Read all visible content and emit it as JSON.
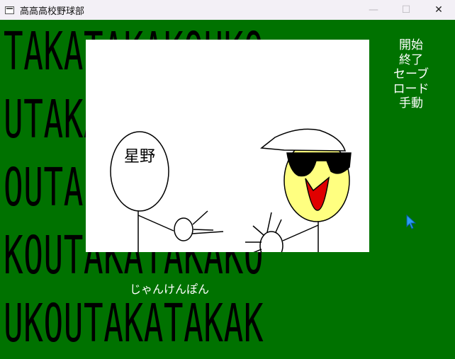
{
  "window": {
    "title": "高高高校野球部",
    "minimize_glyph": "—",
    "maximize_glyph": "☐",
    "close_glyph": "✕"
  },
  "background": {
    "rows": [
      "TAKATAKAKOUKO",
      "UTAKATAKAKOUK",
      "OUTAKATAKAKOU",
      "KOUTAKATAKAKO",
      "UKOUTAKATAKAK"
    ],
    "color": "#007200"
  },
  "scene": {
    "character_name": "星野"
  },
  "menu": {
    "items": [
      {
        "label": "開始"
      },
      {
        "label": "終了"
      },
      {
        "label": "セーブ"
      },
      {
        "label": "ロード"
      },
      {
        "label": "手動"
      }
    ]
  },
  "dialogue": {
    "text": "じゃんけんぽん"
  }
}
